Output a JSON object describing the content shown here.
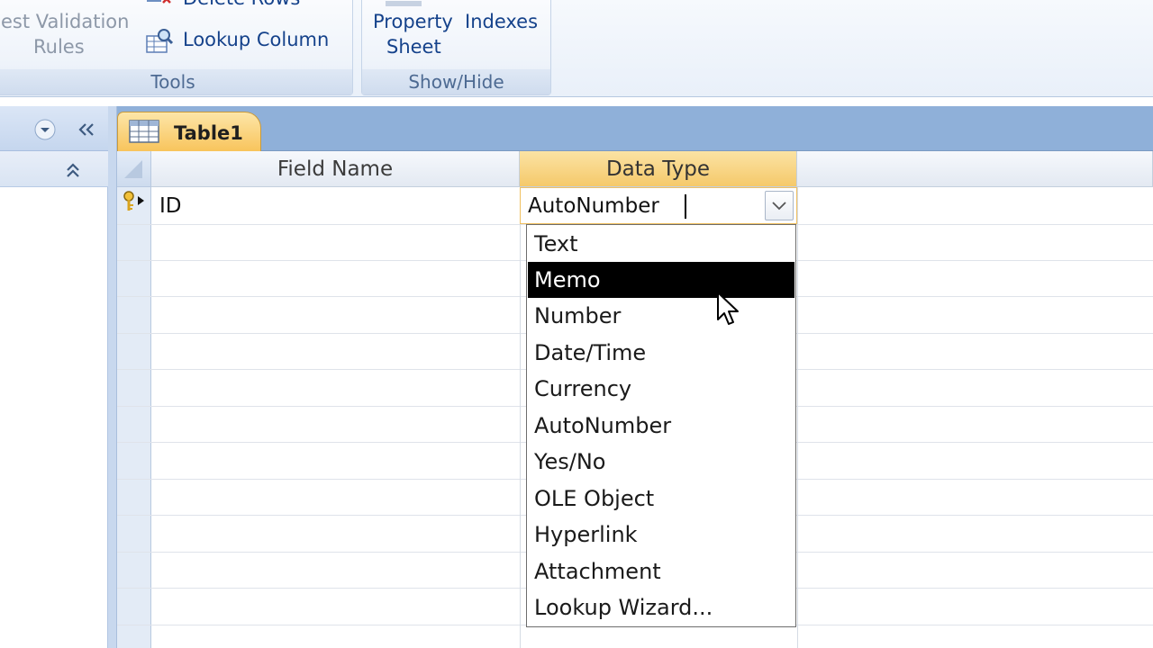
{
  "ribbon": {
    "tools": {
      "label": "Tools",
      "test_validation_line1": "est Validation",
      "test_validation_line2": "Rules",
      "delete_rows": "Delete Rows",
      "lookup_column": "Lookup Column"
    },
    "show_hide": {
      "label": "Show/Hide",
      "property_sheet_line1": "Property",
      "property_sheet_line2": "Sheet",
      "indexes": "Indexes"
    }
  },
  "document_tab": {
    "label": "Table1",
    "icon": "table-icon"
  },
  "grid": {
    "columns": [
      "Field Name",
      "Data Type"
    ],
    "rows": [
      {
        "field_name": "ID",
        "data_type": "AutoNumber",
        "primary_key": true
      }
    ]
  },
  "dropdown": {
    "options": [
      "Text",
      "Memo",
      "Number",
      "Date/Time",
      "Currency",
      "AutoNumber",
      "Yes/No",
      "OLE Object",
      "Hyperlink",
      "Attachment",
      "Lookup Wizard..."
    ],
    "highlighted": "Memo"
  },
  "colors": {
    "ribbon_text": "#15428b",
    "tab_active": "#f8c45c",
    "tabstrip": "#8fb0d9",
    "selection": "#000000"
  }
}
